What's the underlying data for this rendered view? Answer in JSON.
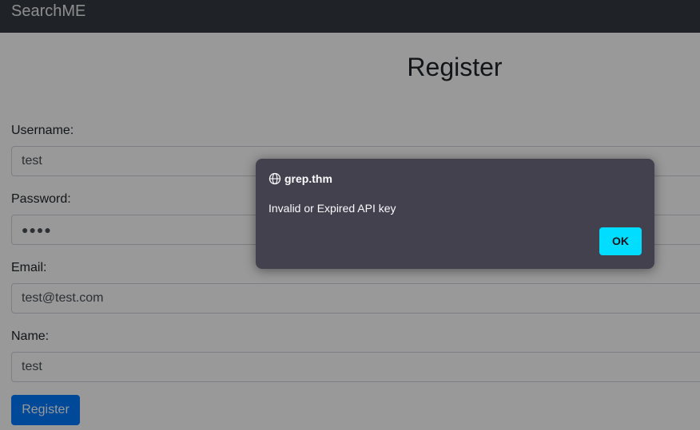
{
  "navbar": {
    "brand": "SearchME"
  },
  "form": {
    "title": "Register",
    "fields": [
      {
        "label": "Username:",
        "value": "test"
      },
      {
        "label": "Password:",
        "value": "●●●●"
      },
      {
        "label": "Email:",
        "value": "test@test.com"
      },
      {
        "label": "Name:",
        "value": "test"
      }
    ],
    "submit_label": "Register"
  },
  "dialog": {
    "origin": "grep.thm",
    "message": "Invalid or Expired API key",
    "ok_label": "OK"
  },
  "icons": {
    "dialog_origin": "globe-icon"
  },
  "colors": {
    "navbar_bg": "#343a40",
    "primary": "#007bff",
    "dialog_bg": "#42414d",
    "dialog_button": "#00ddff"
  }
}
